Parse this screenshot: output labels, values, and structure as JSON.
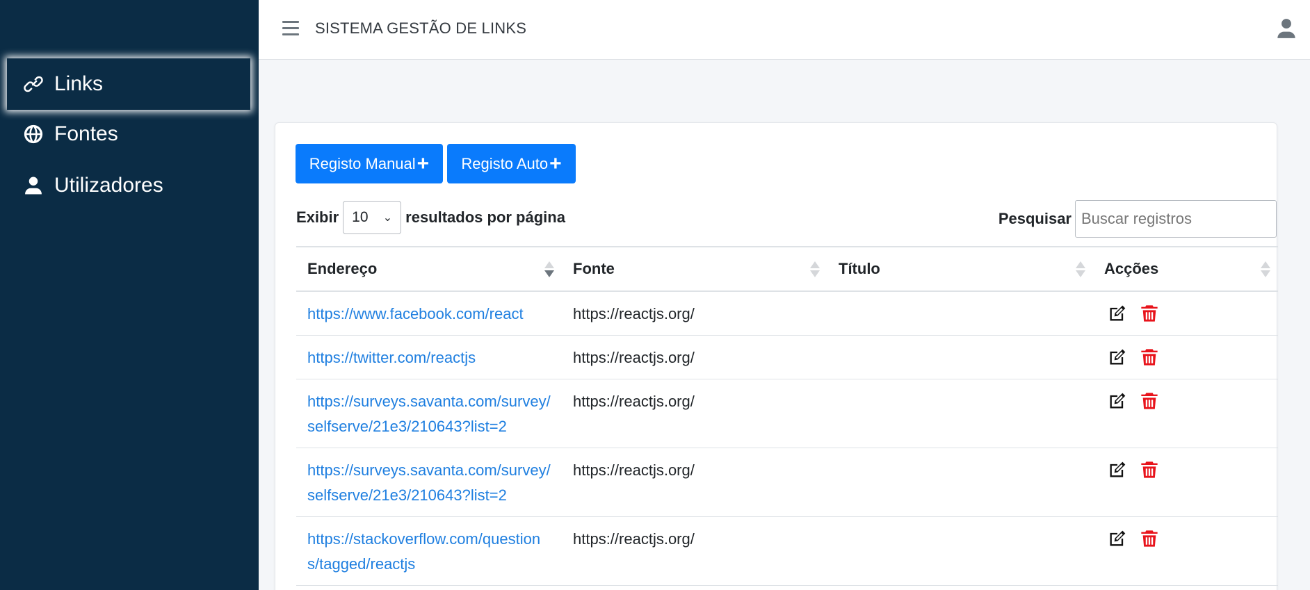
{
  "sidebar": {
    "items": [
      {
        "label": "Links",
        "icon": "link-icon"
      },
      {
        "label": "Fontes",
        "icon": "globe-icon"
      },
      {
        "label": "Utilizadores",
        "icon": "user-icon"
      }
    ]
  },
  "topbar": {
    "title": "SISTEMA GESTÃO DE LINKS"
  },
  "toolbar": {
    "manual_label": "Registo Manual",
    "auto_label": "Registo Auto",
    "plus": "+"
  },
  "length": {
    "prefix": "Exibir",
    "value": "10",
    "suffix": "resultados por página"
  },
  "search": {
    "label": "Pesquisar",
    "placeholder": "Buscar registros"
  },
  "table": {
    "columns": [
      "Endereço",
      "Fonte",
      "Título",
      "Acções"
    ],
    "rows": [
      {
        "endereco": "https://www.facebook.com/react",
        "fonte": "https://reactjs.org/",
        "titulo": ""
      },
      {
        "endereco": "https://twitter.com/reactjs",
        "fonte": "https://reactjs.org/",
        "titulo": ""
      },
      {
        "endereco": "https://surveys.savanta.com/survey/selfserve/21e3/210643?list=2",
        "fonte": "https://reactjs.org/",
        "titulo": ""
      },
      {
        "endereco": "https://surveys.savanta.com/survey/selfserve/21e3/210643?list=2",
        "fonte": "https://reactjs.org/",
        "titulo": ""
      },
      {
        "endereco": "https://stackoverflow.com/questions/tagged/reactjs",
        "fonte": "https://reactjs.org/",
        "titulo": ""
      }
    ]
  },
  "colors": {
    "sidebar_bg": "#0b2c45",
    "primary": "#0a7bfc",
    "link": "#1f7fe0",
    "delete": "#e8131b"
  }
}
